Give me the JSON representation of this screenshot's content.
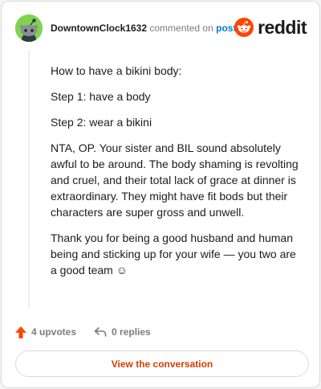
{
  "colors": {
    "accent": "#d93a00",
    "link": "#0079d3",
    "upvote": "#ff4500",
    "avatar_bg": "#7fd44f"
  },
  "header": {
    "username": "DowntownClock1632",
    "action_text": "commented on",
    "post_link": "post",
    "brand": "reddit"
  },
  "comment": {
    "paragraphs": [
      "How to have a bikini body:",
      "Step 1: have a body",
      "Step 2: wear a bikini",
      "NTA, OP. Your sister and BIL sound absolutely awful to be around. The body shaming is revolting and cruel, and their total lack of grace at dinner is extraordinary. They might have fit bods but their characters are super gross and unwell.",
      "Thank you for being a good husband and human being and sticking up for your wife — you two are a good team ☺"
    ]
  },
  "actions": {
    "upvotes": "4 upvotes",
    "replies": "0 replies"
  },
  "cta": {
    "label": "View the conversation"
  },
  "icons": [
    "avatar",
    "reddit-logo-icon",
    "upvote-arrow-icon",
    "reply-arrow-icon"
  ]
}
